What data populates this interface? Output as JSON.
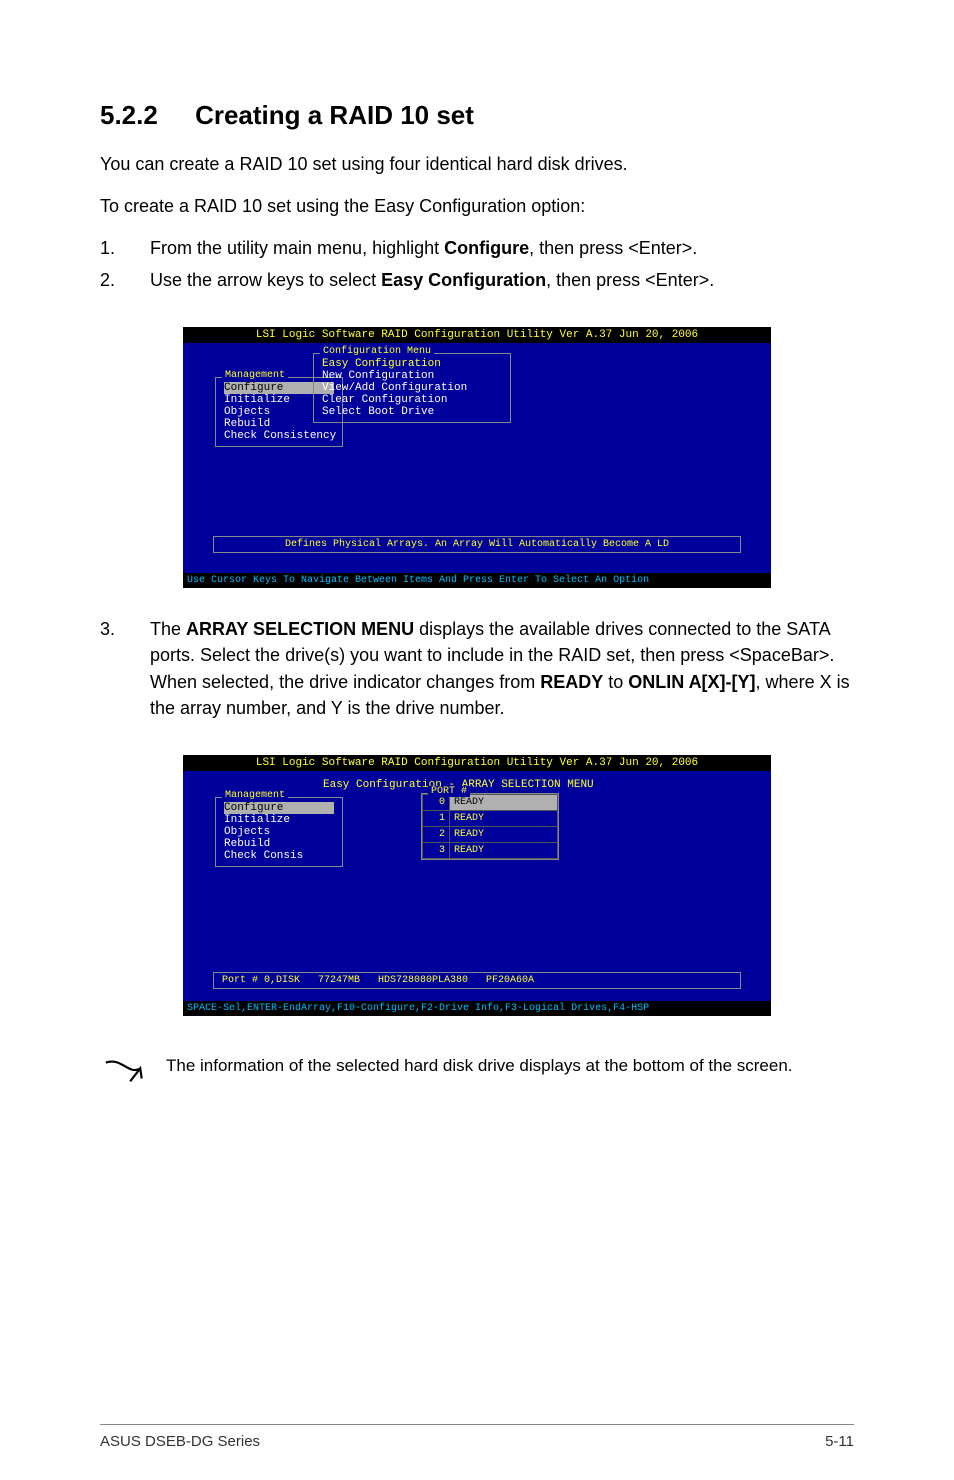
{
  "section": {
    "number": "5.2.2",
    "title": "Creating a RAID 10 set"
  },
  "intro": {
    "p1": "You can create a RAID 10 set using four identical hard disk drives.",
    "p2": "To create a RAID 10 set using the Easy Configuration option:"
  },
  "steps1": {
    "n1": "1.",
    "t1a": "From the utility main menu, highlight ",
    "t1b": "Configure",
    "t1c": ", then press <Enter>.",
    "n2": "2.",
    "t2a": "Use the arrow keys to select ",
    "t2b": "Easy Configuration",
    "t2c": ", then press <Enter>."
  },
  "bios1": {
    "title": "LSI Logic Software RAID Configuration Utility Ver A.37 Jun 20, 2006",
    "mgmt_title": "Management",
    "mgmt_items": [
      "Configure",
      "Initialize",
      "Objects",
      "Rebuild",
      "Check Consistency"
    ],
    "conf_title": "Configuration Menu",
    "conf_items": [
      "Easy Configuration",
      "New Configuration",
      "View/Add Configuration",
      "Clear Configuration",
      "Select Boot Drive"
    ],
    "hint": "Defines Physical Arrays. An Array Will Automatically Become A LD",
    "footer": "Use Cursor Keys To Navigate Between Items And Press Enter To Select An Option"
  },
  "steps2": {
    "n3": "3.",
    "t3a": "The ",
    "t3b": "ARRAY SELECTION MENU",
    "t3c": " displays the available drives connected to the SATA ports. Select the drive(s) you want to include in the RAID set, then press <SpaceBar>. When selected, the drive indicator changes from ",
    "t3d": "READY",
    "t3e": " to ",
    "t3f": "ONLIN A[X]-[Y]",
    "t3g": ", where X is the array number, and Y is the drive number."
  },
  "bios2": {
    "title": "LSI Logic Software RAID Configuration Utility Ver A.37 Jun 20, 2006",
    "mgmt_title": "Management",
    "mgmt_items": [
      "Configure",
      "Initialize",
      "Objects",
      "Rebuild",
      "Check Consis"
    ],
    "arr_title": "Easy Configuration - ARRAY SELECTION MENU",
    "port_title": "PORT #",
    "rows": [
      {
        "idx": "0",
        "stat": "READY",
        "sel": true
      },
      {
        "idx": "1",
        "stat": "READY",
        "sel": false
      },
      {
        "idx": "2",
        "stat": "READY",
        "sel": false
      },
      {
        "idx": "3",
        "stat": "READY",
        "sel": false
      }
    ],
    "status": {
      "a": "Port # 0,DISK",
      "b": "77247MB",
      "c": "HDS728080PLA380",
      "d": "PF20A60A"
    },
    "footer": "SPACE-Sel,ENTER-EndArray,F10-Configure,F2-Drive Info,F3-Logical Drives,F4-HSP"
  },
  "note": "The information of the selected hard disk drive displays at the bottom of the screen.",
  "footer": {
    "left": "ASUS DSEB-DG Series",
    "right": "5-11"
  }
}
